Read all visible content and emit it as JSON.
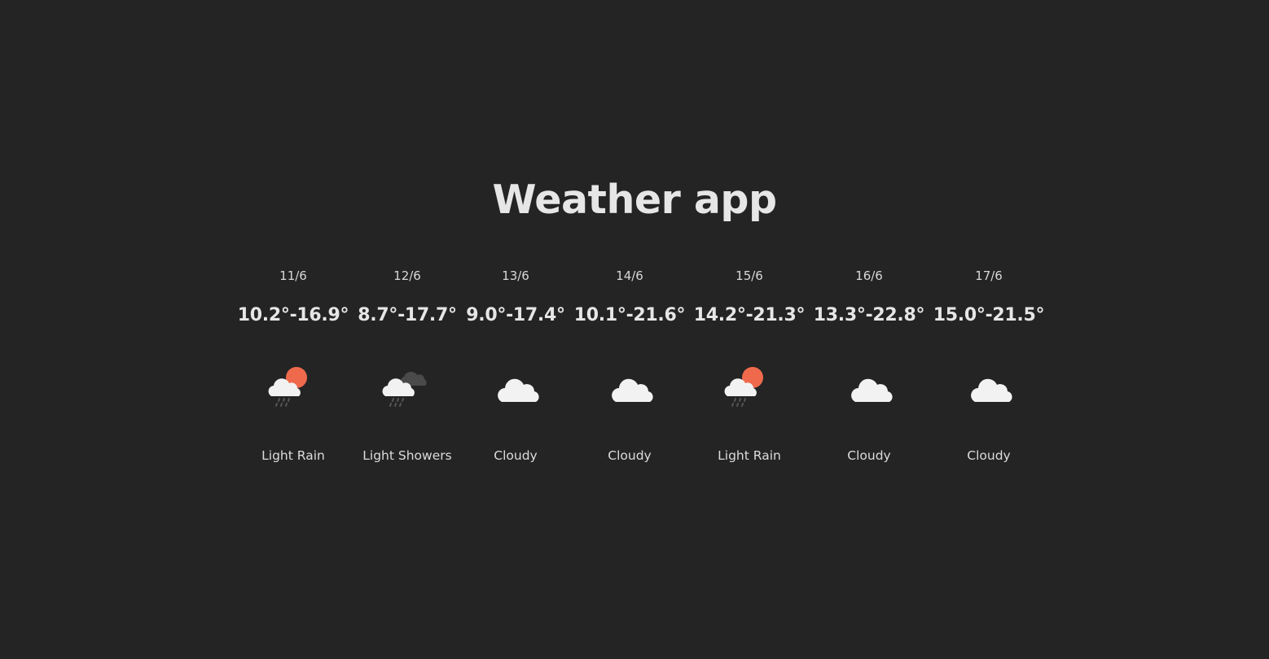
{
  "app": {
    "title": "Weather app"
  },
  "colors": {
    "background": "#242424",
    "text": "#e6e6e6",
    "cloud": "#f2f2f2",
    "sun": "#ef6a4c",
    "dark_cloud": "#4a4a4a",
    "rain": "#555555"
  },
  "forecast": [
    {
      "date": "11/6",
      "temp": "10.2°-16.9°",
      "icon": "sun-cloud-rain-icon",
      "desc": "Light Rain"
    },
    {
      "date": "12/6",
      "temp": "8.7°-17.7°",
      "icon": "showers-icon",
      "desc": "Light Showers"
    },
    {
      "date": "13/6",
      "temp": "9.0°-17.4°",
      "icon": "cloud-icon",
      "desc": "Cloudy"
    },
    {
      "date": "14/6",
      "temp": "10.1°-21.6°",
      "icon": "cloud-icon",
      "desc": "Cloudy"
    },
    {
      "date": "15/6",
      "temp": "14.2°-21.3°",
      "icon": "sun-cloud-rain-icon",
      "desc": "Light Rain"
    },
    {
      "date": "16/6",
      "temp": "13.3°-22.8°",
      "icon": "cloud-icon",
      "desc": "Cloudy"
    },
    {
      "date": "17/6",
      "temp": "15.0°-21.5°",
      "icon": "cloud-icon",
      "desc": "Cloudy"
    }
  ]
}
